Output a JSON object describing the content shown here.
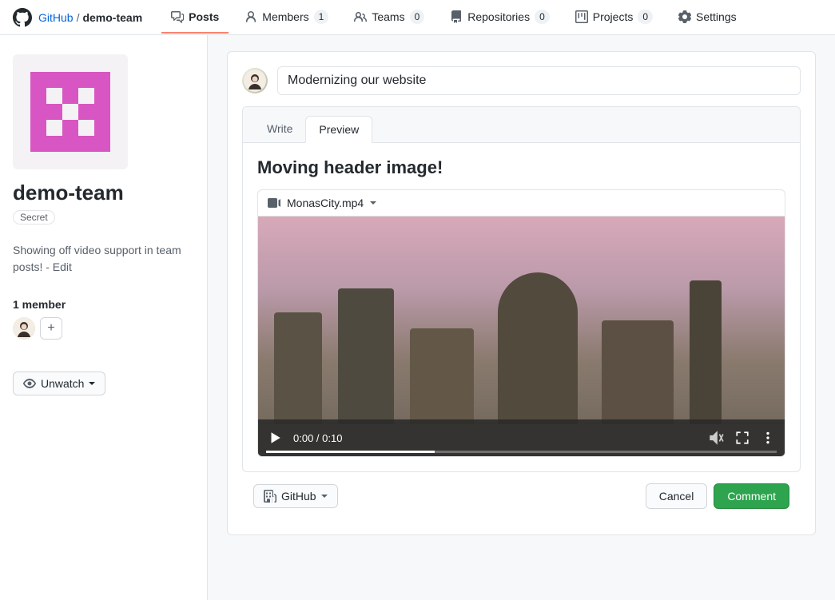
{
  "breadcrumb": {
    "org": "GitHub",
    "team": "demo-team"
  },
  "nav": {
    "posts": {
      "label": "Posts"
    },
    "members": {
      "label": "Members",
      "count": "1"
    },
    "teams": {
      "label": "Teams",
      "count": "0"
    },
    "repositories": {
      "label": "Repositories",
      "count": "0"
    },
    "projects": {
      "label": "Projects",
      "count": "0"
    },
    "settings": {
      "label": "Settings"
    }
  },
  "sidebar": {
    "team_name": "demo-team",
    "visibility_badge": "Secret",
    "description": "Showing off video support in team posts! - Edit",
    "members_label": "1 member",
    "unwatch_label": "Unwatch"
  },
  "post": {
    "title_value": "Modernizing our website",
    "tabs": {
      "write": "Write",
      "preview": "Preview"
    },
    "preview_heading": "Moving header image!",
    "video_filename": "MonasCity.mp4",
    "video_time": "0:00 / 0:10",
    "org_dropdown": "GitHub",
    "cancel_label": "Cancel",
    "comment_label": "Comment"
  }
}
